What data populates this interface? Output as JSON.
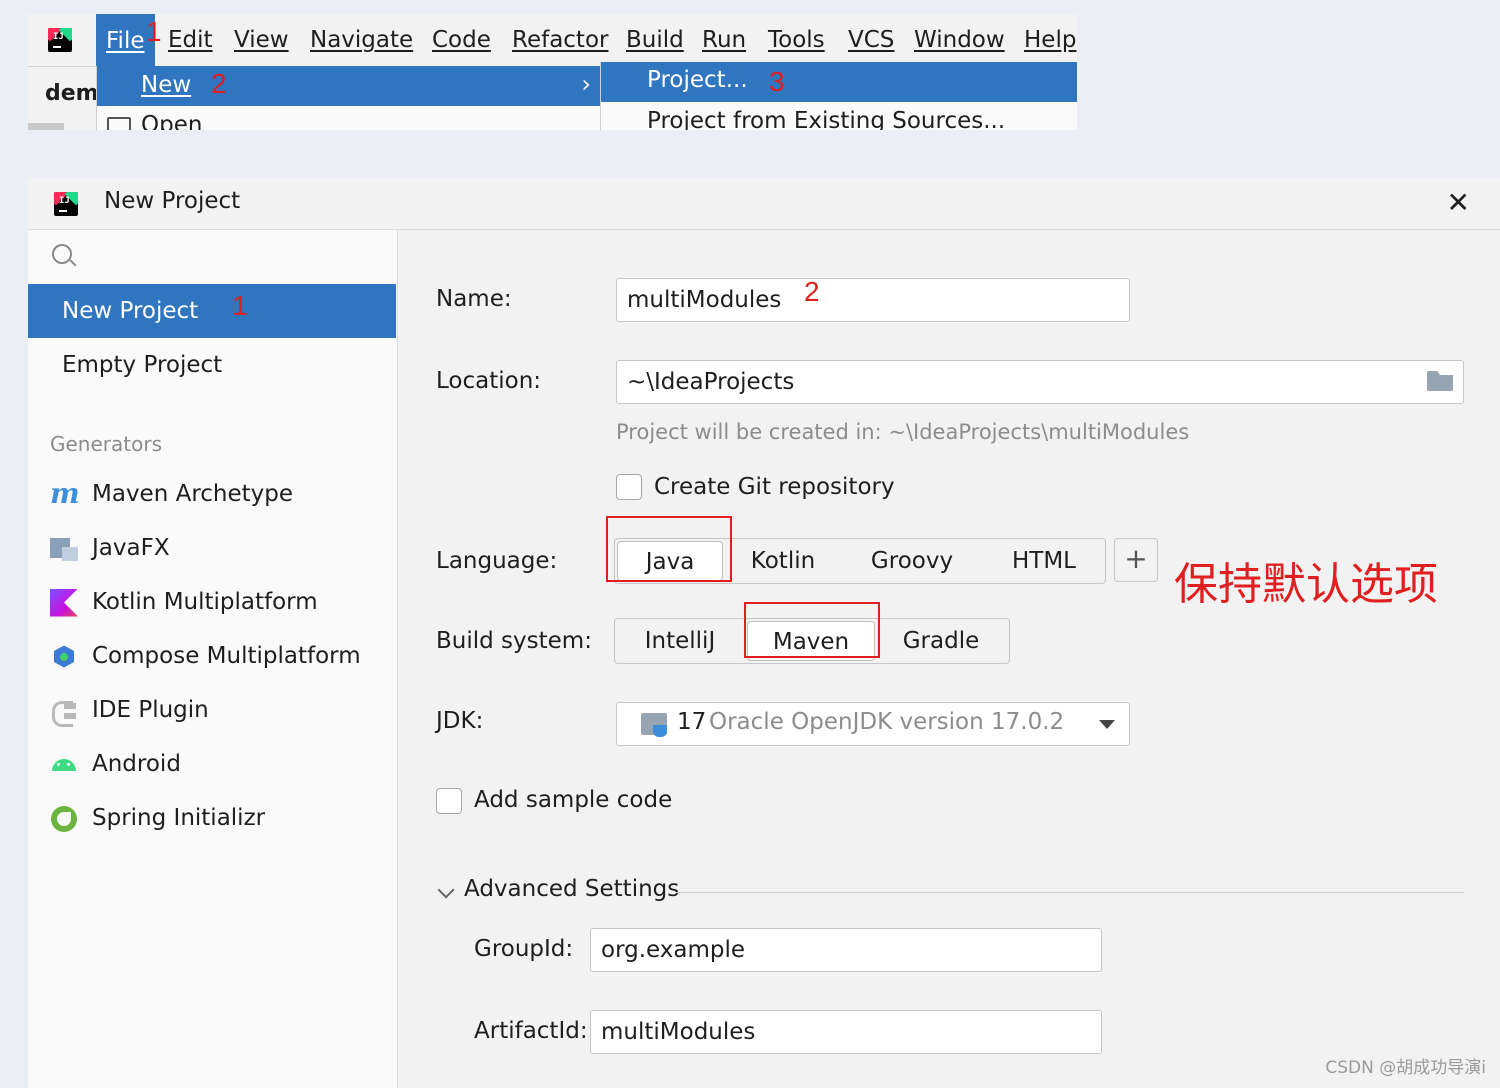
{
  "menubar": {
    "items": [
      {
        "label": "File",
        "active": true
      },
      {
        "label": "Edit"
      },
      {
        "label": "View"
      },
      {
        "label": "Navigate"
      },
      {
        "label": "Code"
      },
      {
        "label": "Refactor"
      },
      {
        "label": "Build"
      },
      {
        "label": "Run"
      },
      {
        "label": "Tools"
      },
      {
        "label": "VCS"
      },
      {
        "label": "Window"
      },
      {
        "label": "Help"
      }
    ],
    "tab_partial": "dem",
    "dropdown": {
      "new_label": "New",
      "open_label": "Open"
    },
    "submenu": {
      "project_label": "Project...",
      "existing_label": "Project from Existing Sources..."
    },
    "annotations": {
      "n1": "1",
      "n2": "2",
      "n3": "3"
    }
  },
  "dialog": {
    "title": "New Project",
    "close_glyph": "✕",
    "sidebar": {
      "items": [
        {
          "label": "New Project",
          "selected": true
        },
        {
          "label": "Empty Project"
        }
      ],
      "generators_heading": "Generators",
      "generators": [
        {
          "label": "Maven Archetype",
          "icon": "maven-icon"
        },
        {
          "label": "JavaFX",
          "icon": "javafx-icon"
        },
        {
          "label": "Kotlin Multiplatform",
          "icon": "kotlin-icon"
        },
        {
          "label": "Compose Multiplatform",
          "icon": "compose-icon"
        },
        {
          "label": "IDE Plugin",
          "icon": "plugin-icon"
        },
        {
          "label": "Android",
          "icon": "android-icon"
        },
        {
          "label": "Spring Initializr",
          "icon": "spring-icon"
        }
      ],
      "annotation": "1"
    },
    "form": {
      "name_label": "Name:",
      "name_value": "multiModules",
      "name_annotation": "2",
      "location_label": "Location:",
      "location_value": "~\\IdeaProjects",
      "location_hint": "Project will be created in: ~\\IdeaProjects\\multiModules",
      "git_label": "Create Git repository",
      "language_label": "Language:",
      "languages": [
        "Java",
        "Kotlin",
        "Groovy",
        "HTML"
      ],
      "language_selected": "Java",
      "plus_glyph": "+",
      "build_label": "Build system:",
      "build_systems": [
        "IntelliJ",
        "Maven",
        "Gradle"
      ],
      "build_selected": "Maven",
      "jdk_label": "JDK:",
      "jdk_version": "17",
      "jdk_desc": "Oracle OpenJDK version 17.0.2",
      "sample_label": "Add sample code",
      "advanced_label": "Advanced Settings",
      "groupid_label": "GroupId:",
      "groupid_value": "org.example",
      "artifactid_label": "ArtifactId:",
      "artifactid_value": "multiModules"
    },
    "annotation_cn": "保持默认选项"
  },
  "watermark": "CSDN @胡成功导演i",
  "colors": {
    "accent": "#2f75c0",
    "annotation": "#e02020"
  }
}
